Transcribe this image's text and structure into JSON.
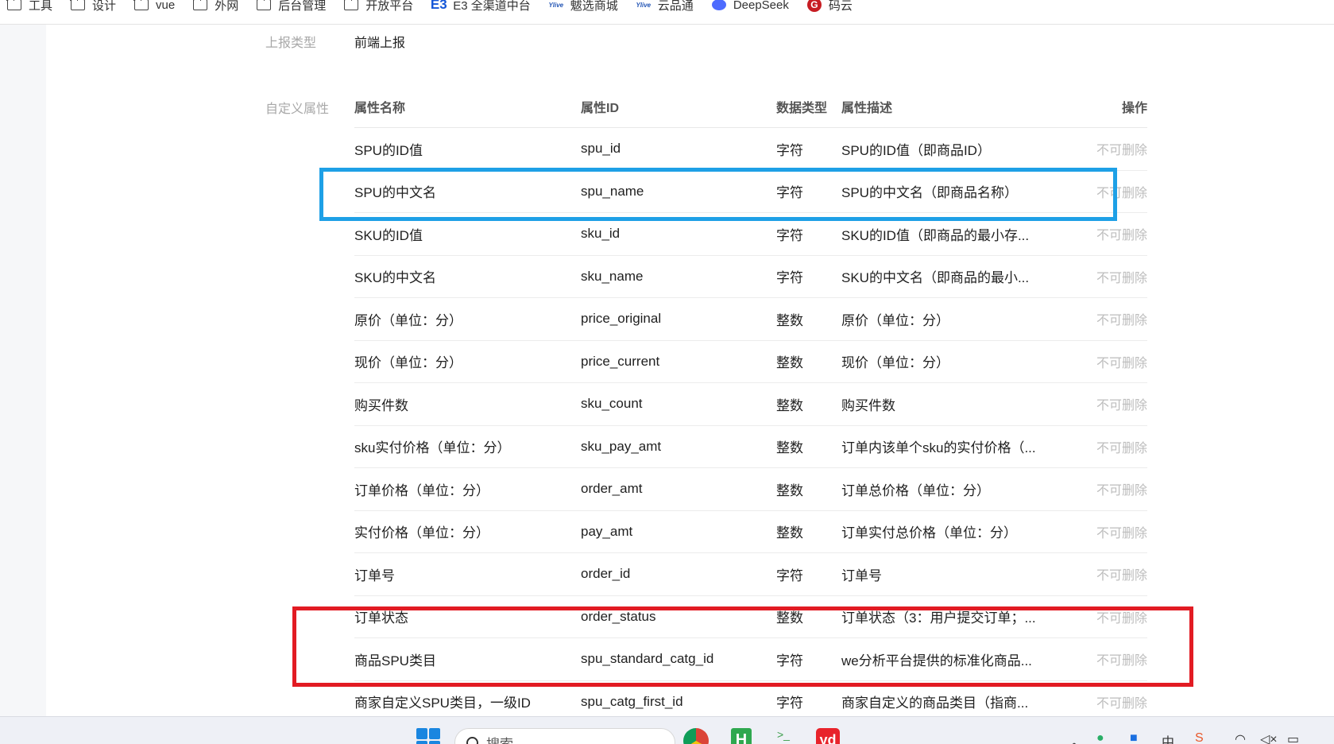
{
  "bookmarks": [
    {
      "label": "工具",
      "icon": "folder-icon"
    },
    {
      "label": "设计",
      "icon": "folder-icon"
    },
    {
      "label": "vue",
      "icon": "folder-icon"
    },
    {
      "label": "外网",
      "icon": "folder-icon"
    },
    {
      "label": "后台管理",
      "icon": "folder-icon"
    },
    {
      "label": "开放平台",
      "icon": "folder-icon"
    },
    {
      "label": "E3 全渠道中台",
      "icon": "e3-logo-icon"
    },
    {
      "label": "魃选商城",
      "icon": "yl-logo-icon"
    },
    {
      "label": "云品通",
      "icon": "yl-logo-icon"
    },
    {
      "label": "DeepSeek",
      "icon": "deepseek-icon"
    },
    {
      "label": "码云",
      "icon": "gitee-icon"
    }
  ],
  "form": {
    "report_type_label": "上报类型",
    "report_type_value": "前端上报",
    "custom_attr_label": "自定义属性"
  },
  "table": {
    "headers": {
      "name": "属性名称",
      "id": "属性ID",
      "type": "数据类型",
      "desc": "属性描述",
      "op": "操作"
    },
    "rows": [
      {
        "name": "SPU的ID值",
        "id": "spu_id",
        "type": "字符",
        "desc": "SPU的ID值（即商品ID）",
        "op": "不可删除"
      },
      {
        "name": "SPU的中文名",
        "id": "spu_name",
        "type": "字符",
        "desc": "SPU的中文名（即商品名称）",
        "op": "不可删除"
      },
      {
        "name": "SKU的ID值",
        "id": "sku_id",
        "type": "字符",
        "desc": "SKU的ID值（即商品的最小存...",
        "op": "不可删除"
      },
      {
        "name": "SKU的中文名",
        "id": "sku_name",
        "type": "字符",
        "desc": "SKU的中文名（即商品的最小...",
        "op": "不可删除"
      },
      {
        "name": "原价（单位：分）",
        "id": "price_original",
        "type": "整数",
        "desc": "原价（单位：分）",
        "op": "不可删除"
      },
      {
        "name": "现价（单位：分）",
        "id": "price_current",
        "type": "整数",
        "desc": "现价（单位：分）",
        "op": "不可删除"
      },
      {
        "name": "购买件数",
        "id": "sku_count",
        "type": "整数",
        "desc": "购买件数",
        "op": "不可删除"
      },
      {
        "name": "sku实付价格（单位：分）",
        "id": "sku_pay_amt",
        "type": "整数",
        "desc": "订单内该单个sku的实付价格（...",
        "op": "不可删除"
      },
      {
        "name": "订单价格（单位：分）",
        "id": "order_amt",
        "type": "整数",
        "desc": "订单总价格（单位：分）",
        "op": "不可删除"
      },
      {
        "name": "实付价格（单位：分）",
        "id": "pay_amt",
        "type": "整数",
        "desc": "订单实付总价格（单位：分）",
        "op": "不可删除"
      },
      {
        "name": "订单号",
        "id": "order_id",
        "type": "字符",
        "desc": "订单号",
        "op": "不可删除"
      },
      {
        "name": "订单状态",
        "id": "order_status",
        "type": "整数",
        "desc": "订单状态（3：用户提交订单；...",
        "op": "不可删除"
      },
      {
        "name": "商品SPU类目",
        "id": "spu_standard_catg_id",
        "type": "字符",
        "desc": "we分析平台提供的标准化商品...",
        "op": "不可删除"
      },
      {
        "name": "商家自定义SPU类目，一级ID",
        "id": "spu_catg_first_id",
        "type": "字符",
        "desc": "商家自定义的商品类目（指商...",
        "op": "不可删除"
      }
    ]
  },
  "taskbar": {
    "search_placeholder": "搜索",
    "apps": [
      "chrome-icon",
      "hbuilder-icon",
      "terminal-icon",
      "youdao-icon"
    ],
    "tray": [
      "chevron-up-icon",
      "wechat-icon",
      "app-icon",
      "ime-zh-icon",
      "wifi-icon",
      "volume-muted-icon",
      "battery-icon"
    ]
  },
  "colors": {
    "highlight_blue": "#1ea0e6",
    "highlight_red": "#e21b23"
  }
}
